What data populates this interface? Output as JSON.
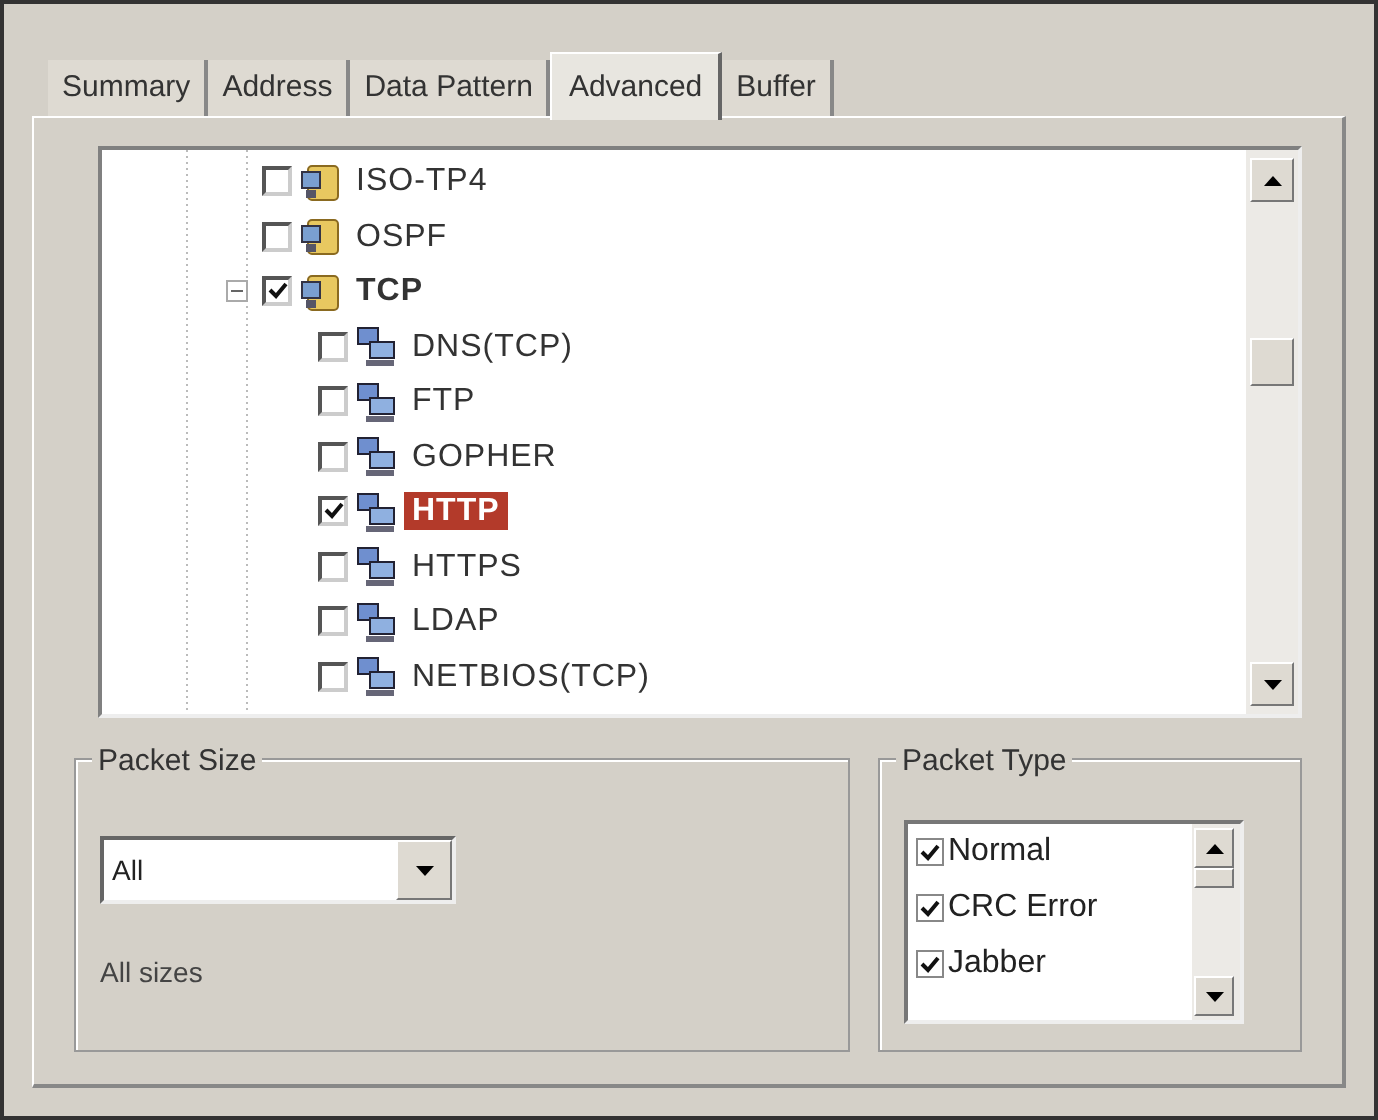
{
  "tabs": [
    {
      "label": "Summary",
      "selected": false
    },
    {
      "label": "Address",
      "selected": false
    },
    {
      "label": "Data Pattern",
      "selected": false
    },
    {
      "label": "Advanced",
      "selected": true
    },
    {
      "label": "Buffer",
      "selected": false
    }
  ],
  "tree": {
    "items": [
      {
        "label": "ISO-TP4",
        "kind": "protocol",
        "checked": false,
        "bold": false,
        "selected": false
      },
      {
        "label": "OSPF",
        "kind": "protocol",
        "checked": false,
        "bold": false,
        "selected": false
      },
      {
        "label": "TCP",
        "kind": "protocol",
        "checked": true,
        "bold": true,
        "selected": false,
        "expanded": true,
        "children": [
          {
            "label": "DNS(TCP)",
            "kind": "service",
            "checked": false,
            "bold": false,
            "selected": false
          },
          {
            "label": "FTP",
            "kind": "service",
            "checked": false,
            "bold": false,
            "selected": false
          },
          {
            "label": "GOPHER",
            "kind": "service",
            "checked": false,
            "bold": false,
            "selected": false
          },
          {
            "label": "HTTP",
            "kind": "service",
            "checked": true,
            "bold": true,
            "selected": true
          },
          {
            "label": "HTTPS",
            "kind": "service",
            "checked": false,
            "bold": false,
            "selected": false
          },
          {
            "label": "LDAP",
            "kind": "service",
            "checked": false,
            "bold": false,
            "selected": false
          },
          {
            "label": "NETBIOS(TCP)",
            "kind": "service",
            "checked": false,
            "bold": false,
            "selected": false
          }
        ]
      }
    ]
  },
  "packet_size": {
    "title": "Packet Size",
    "value": "All",
    "description": "All sizes"
  },
  "packet_type": {
    "title": "Packet Type",
    "items": [
      {
        "label": "Normal",
        "checked": true
      },
      {
        "label": "CRC Error",
        "checked": true
      },
      {
        "label": "Jabber",
        "checked": true
      }
    ]
  }
}
